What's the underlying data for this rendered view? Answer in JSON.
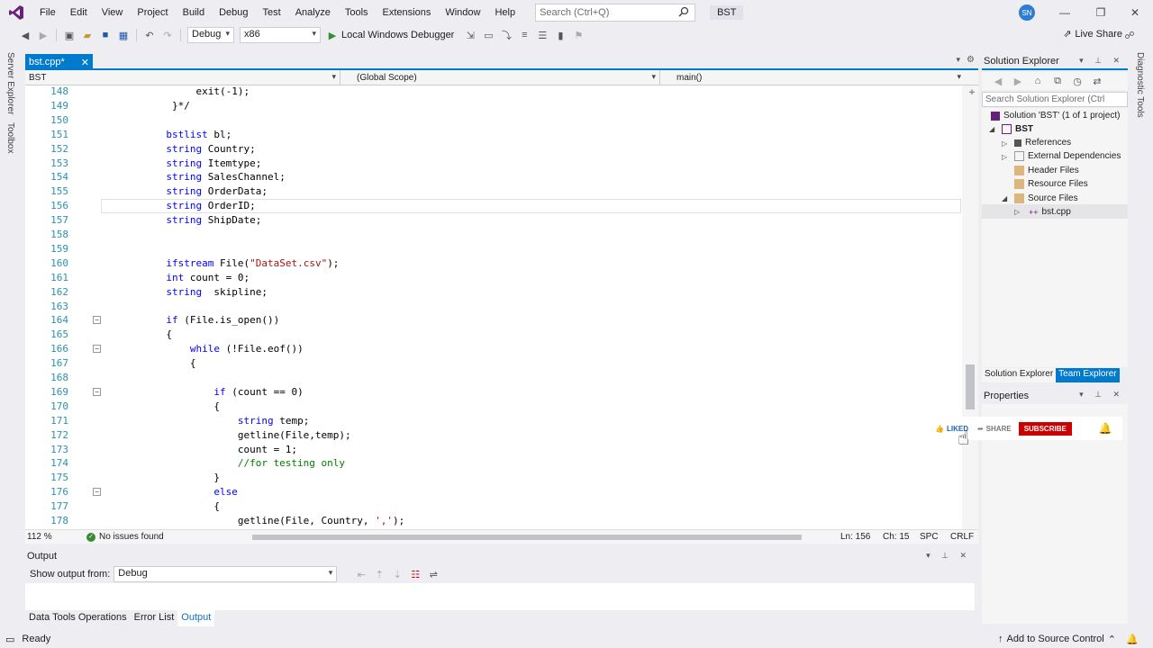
{
  "menu": [
    "File",
    "Edit",
    "View",
    "Project",
    "Build",
    "Debug",
    "Test",
    "Analyze",
    "Tools",
    "Extensions",
    "Window",
    "Help"
  ],
  "search": {
    "placeholder": "Search (Ctrl+Q)"
  },
  "solution_badge": "BST",
  "user_initials": "SN",
  "toolbar": {
    "config": "Debug",
    "platform": "x86",
    "run_label": "Local Windows Debugger",
    "live_share": "Live Share"
  },
  "left_tabs": [
    "Server Explorer",
    "Toolbox"
  ],
  "right_tabs": [
    "Diagnostic Tools"
  ],
  "editor": {
    "file_tab": "bst.cpp*",
    "nav_project": "BST",
    "nav_scope": "(Global Scope)",
    "nav_member": "main()",
    "zoom": "112 %",
    "issues": "No issues found",
    "line_col": "Ln: 156",
    "char": "Ch: 15",
    "spc": "SPC",
    "eol": "CRLF"
  },
  "code_lines": [
    {
      "n": "148",
      "t": "            exit(-1);"
    },
    {
      "n": "149",
      "t": "        }*/"
    },
    {
      "n": "150",
      "t": ""
    },
    {
      "n": "151",
      "t": "       bstlist bl;"
    },
    {
      "n": "152",
      "t": "       string Country;"
    },
    {
      "n": "153",
      "t": "       string Itemtype;"
    },
    {
      "n": "154",
      "t": "       string SalesChannel;"
    },
    {
      "n": "155",
      "t": "       string OrderData;"
    },
    {
      "n": "156",
      "t": "       string OrderID;"
    },
    {
      "n": "157",
      "t": "       string ShipDate;"
    },
    {
      "n": "158",
      "t": ""
    },
    {
      "n": "159",
      "t": ""
    },
    {
      "n": "160",
      "t": "       ifstream File(\"DataSet.csv\");"
    },
    {
      "n": "161",
      "t": "       int count = 0;"
    },
    {
      "n": "162",
      "t": "       string  skipline;"
    },
    {
      "n": "163",
      "t": ""
    },
    {
      "n": "164",
      "t": "       if (File.is_open())"
    },
    {
      "n": "165",
      "t": "       {"
    },
    {
      "n": "166",
      "t": "           while (!File.eof())"
    },
    {
      "n": "167",
      "t": "           {"
    },
    {
      "n": "168",
      "t": ""
    },
    {
      "n": "169",
      "t": "               if (count == 0)"
    },
    {
      "n": "170",
      "t": "               {"
    },
    {
      "n": "171",
      "t": "                   string temp;"
    },
    {
      "n": "172",
      "t": "                   getline(File,temp);"
    },
    {
      "n": "173",
      "t": "                   count = 1;"
    },
    {
      "n": "174",
      "t": "                   //for testing only"
    },
    {
      "n": "175",
      "t": "               }"
    },
    {
      "n": "176",
      "t": "               else"
    },
    {
      "n": "177",
      "t": "               {"
    },
    {
      "n": "178",
      "t": "                   getline(File, Country, ',');"
    }
  ],
  "output": {
    "title": "Output",
    "show_from_label": "Show output from:",
    "show_from_value": "Debug",
    "tabs": [
      "Data Tools Operations",
      "Error List",
      "Output"
    ]
  },
  "solution_explorer": {
    "title": "Solution Explorer",
    "search_placeholder": "Search Solution Explorer (Ctrl",
    "tree": [
      {
        "label": "Solution 'BST' (1 of 1 project)",
        "level": 0
      },
      {
        "label": "BST",
        "level": 1
      },
      {
        "label": "References",
        "level": 2
      },
      {
        "label": "External Dependencies",
        "level": 2
      },
      {
        "label": "Header Files",
        "level": 2
      },
      {
        "label": "Resource Files",
        "level": 2
      },
      {
        "label": "Source Files",
        "level": 2
      },
      {
        "label": "bst.cpp",
        "level": 3
      }
    ],
    "tabs": [
      "Solution Explorer",
      "Team Explorer"
    ]
  },
  "properties": {
    "title": "Properties"
  },
  "overlay": {
    "liked": "LIKED",
    "share": "SHARE",
    "subscribe": "SUBSCRIBE"
  },
  "status": {
    "ready": "Ready",
    "source_control": "Add to Source Control"
  },
  "colors": {
    "accent": "#007acc",
    "keyword": "#0000ff",
    "type": "#2b91af",
    "string": "#a31515",
    "comment": "#008000",
    "subscribe": "#cc0000"
  }
}
